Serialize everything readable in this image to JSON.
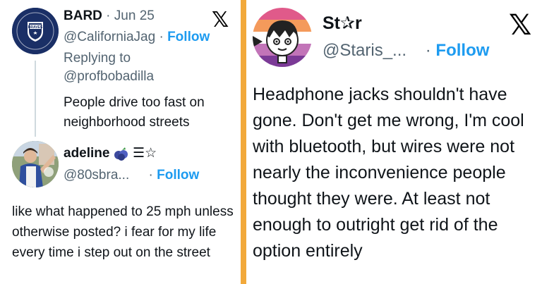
{
  "left_tweet": {
    "name": "BARD",
    "separator": "·",
    "date": "Jun 25",
    "handle": "@CaliforniaJag",
    "handle_sep": "·",
    "follow_label": "Follow",
    "replying_to_label": "Replying to",
    "replying_to_handle": "@profbobadilla",
    "body": "People drive too fast on neighborhood streets",
    "avatar_text": "BRAVES"
  },
  "reply_tweet": {
    "name": "adeline",
    "name_extra": "☰☆",
    "handle": "@80sbra...",
    "handle_sep": "·",
    "follow_label": "Follow",
    "body": "like what happened to 25 mph unless otherwise posted? i fear for my life every time i step out on the street"
  },
  "right_tweet": {
    "name": "St✰r",
    "handle": "@Staris_...",
    "handle_sep": "·",
    "follow_label": "Follow",
    "body": "Headphone jacks shouldn't have gone. Don't get me wrong, I'm cool with bluetooth, but wires were not nearly the inconvenience people thought they were. At least not enough to outright get rid of the option entirely"
  },
  "icons": {
    "x_logo": "x-logo-icon",
    "blueberry": "blueberry-icon"
  },
  "colors": {
    "follow_blue": "#1d9bf0",
    "secondary_gray": "#536471",
    "divider_orange": "#f2a93b",
    "thread_line": "#cfd9de"
  }
}
